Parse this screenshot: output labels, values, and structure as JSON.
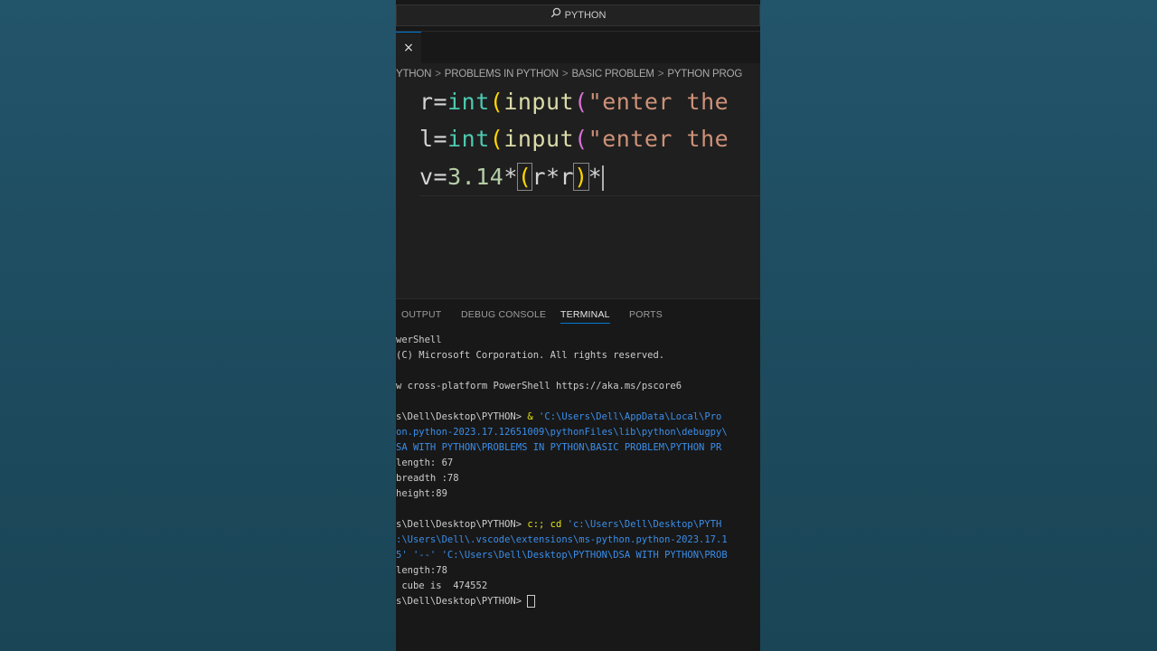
{
  "window": {
    "search_text": "PYTHON"
  },
  "tab": {
    "close_glyph": "×"
  },
  "breadcrumb": {
    "items": [
      "YTHON",
      "PROBLEMS IN PYTHON",
      "BASIC PROBLEM",
      "PYTHON PROG"
    ],
    "separator": ">"
  },
  "editor": {
    "line1": {
      "var": "r=",
      "int": "int",
      "open1": "(",
      "input": "input",
      "open2": "(",
      "str": "\"enter the"
    },
    "line2": {
      "var": "l=",
      "int": "int",
      "open1": "(",
      "input": "input",
      "open2": "(",
      "str": "\"enter the"
    },
    "line3": {
      "var": "v=",
      "num": "3.14",
      "mul1": "*",
      "open": "(",
      "expr": "r*r",
      "close": ")",
      "mul2": "*"
    }
  },
  "panel": {
    "tabs": [
      "OUTPUT",
      "DEBUG CONSOLE",
      "TERMINAL",
      "PORTS"
    ],
    "active_tab": "TERMINAL"
  },
  "terminal": {
    "l1": "werShell",
    "l2": "(C) Microsoft Corporation. All rights reserved.",
    "l3": "w cross-platform PowerShell https://aka.ms/pscore6",
    "l4_prompt": "s\\Dell\\Desktop\\PYTHON>",
    "l4_cmd": " & ",
    "l4_path": "'C:\\Users\\Dell\\AppData\\Local\\Pro",
    "l5": "on.python-2023.17.12651009\\pythonFiles\\lib\\python\\debugpy\\",
    "l6": "SA WITH PYTHON\\PROBLEMS IN PYTHON\\BASIC PROBLEM\\PYTHON PR",
    "l7": "length: 67",
    "l8": "breadth :78",
    "l9": "height:89",
    "l10_prompt": "s\\Dell\\Desktop\\PYTHON>",
    "l10_cmd": " c:; cd ",
    "l10_path": "'c:\\Users\\Dell\\Desktop\\PYTH",
    "l11": ":\\Users\\Dell\\.vscode\\extensions\\ms-python.python-2023.17.1",
    "l12": "5' '--' 'C:\\Users\\Dell\\Desktop\\PYTHON\\DSA WITH PYTHON\\PROB",
    "l13": "length:78",
    "l14": " cube is  474552",
    "l15_prompt": "s\\Dell\\Desktop\\PYTHON> "
  },
  "colors": {
    "background": "#1e4a5c",
    "editor_bg": "#1f1f1f",
    "accent": "#0078d4"
  }
}
